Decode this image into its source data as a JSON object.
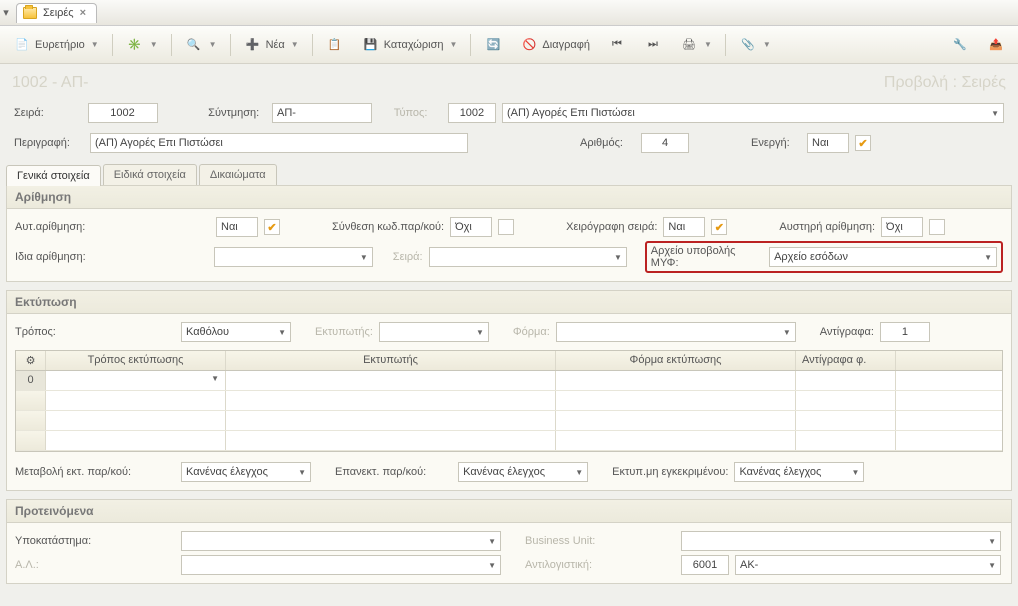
{
  "window": {
    "tab_title": "Σειρές"
  },
  "toolbar": {
    "index": "Ευρετήριο",
    "new": "Νέα",
    "save": "Καταχώριση",
    "delete": "Διαγραφή"
  },
  "breadcrumb": {
    "left": "1002 - ΑΠ-",
    "right": "Προβολή : Σειρές"
  },
  "header": {
    "series_label": "Σειρά:",
    "series_value": "1002",
    "abbrev_label": "Σύντμηση:",
    "abbrev_value": "ΑΠ-",
    "type_label": "Τύπος:",
    "type_code": "1002",
    "type_desc": "(ΑΠ) Αγορές Επι Πιστώσει",
    "desc_label": "Περιγραφή:",
    "desc_value": "(ΑΠ) Αγορές Επι Πιστώσει",
    "number_label": "Αριθμός:",
    "number_value": "4",
    "active_label": "Ενεργή:",
    "active_value": "Ναι"
  },
  "tabs": {
    "t1": "Γενικά στοιχεία",
    "t2": "Ειδικά στοιχεία",
    "t3": "Δικαιώματα"
  },
  "numbering": {
    "title": "Αρίθμηση",
    "auto_label": "Αυτ.αρίθμηση:",
    "auto_value": "Ναι",
    "compose_label": "Σύνθεση κωδ.παρ/κού:",
    "compose_value": "Όχι",
    "manual_label": "Χειρόγραφη σειρά:",
    "manual_value": "Ναι",
    "strict_label": "Αυστηρή αρίθμηση:",
    "strict_value": "Όχι",
    "same_label": "Ιδια αρίθμηση:",
    "same_value": "",
    "series2_label": "Σειρά:",
    "series2_value": "",
    "myf_label": "Αρχείο υποβολής ΜΥΦ:",
    "myf_value": "Αρχείο εσόδων"
  },
  "printing": {
    "title": "Εκτύπωση",
    "mode_label": "Τρόπος:",
    "mode_value": "Καθόλου",
    "printer_label": "Εκτυπωτής:",
    "printer_value": "",
    "form_label": "Φόρμα:",
    "form_value": "",
    "copies_label": "Αντίγραφα:",
    "copies_value": "1",
    "grid_headers": {
      "h1": "Τρόπος εκτύπωσης",
      "h2": "Εκτυπωτής",
      "h3": "Φόρμα εκτύπωσης",
      "h4": "Αντίγραφα  φ."
    },
    "grid_first_idx": "0",
    "change_label": "Μεταβολή εκτ. παρ/κού:",
    "change_value": "Κανένας έλεγχος",
    "reprint_label": "Επανεκτ. παρ/κού:",
    "reprint_value": "Κανένας έλεγχος",
    "unapproved_label": "Εκτυπ.μη εγκεκριμένου:",
    "unapproved_value": "Κανένας έλεγχος"
  },
  "suggested": {
    "title": "Προτεινόμενα",
    "branch_label": "Υποκατάστημα:",
    "branch_value": "",
    "bu_label": "Business Unit:",
    "bu_value": "",
    "al_label": "Α.Λ.:",
    "al_value": "",
    "counter_label": "Αντιλογιστική:",
    "counter_code": "6001",
    "counter_desc": "ΑΚ-"
  }
}
